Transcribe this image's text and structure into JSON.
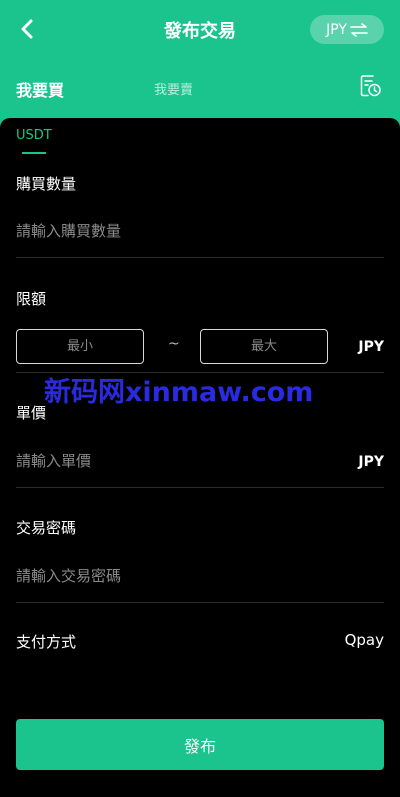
{
  "header": {
    "title": "發布交易",
    "currency_button": "JPY",
    "tab_buy": "我要買",
    "tab_sell": "我要賣"
  },
  "coin": {
    "selected": "USDT"
  },
  "form": {
    "quantity": {
      "label": "購買數量",
      "placeholder": "請輸入購買數量"
    },
    "limit": {
      "label": "限額",
      "min_placeholder": "最小",
      "separator": "~",
      "max_placeholder": "最大",
      "currency": "JPY"
    },
    "price": {
      "label": "單價",
      "placeholder": "請輸入單價",
      "currency": "JPY"
    },
    "password": {
      "label": "交易密碼",
      "placeholder": "請輸入交易密碼"
    },
    "payment": {
      "label": "支付方式",
      "value": "Qpay"
    }
  },
  "submit_label": "發布",
  "watermark": "新码网xinmaw.com",
  "icons": {
    "back": "chevron-left-icon",
    "swap": "swap-arrows-icon",
    "history": "order-history-icon"
  },
  "colors": {
    "accent": "#1bc38d",
    "background": "#000000",
    "watermark": "#2a2ae0"
  }
}
